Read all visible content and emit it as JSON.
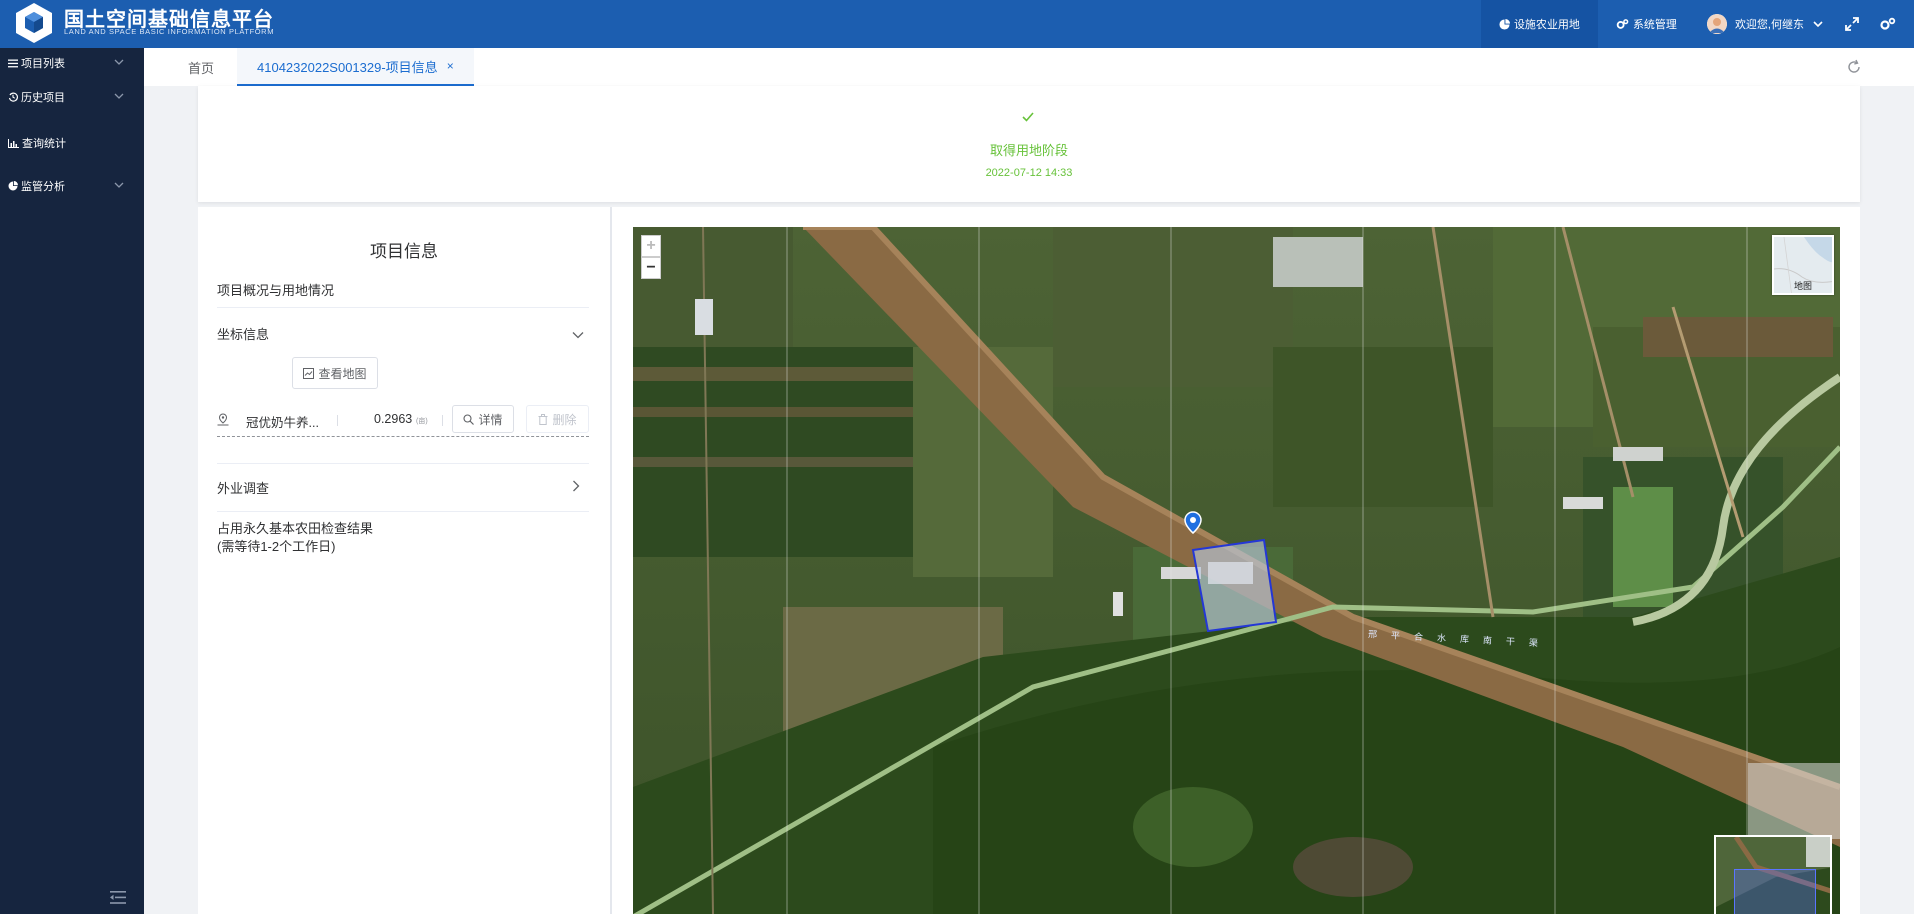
{
  "header": {
    "title": "国土空间基础信息平台",
    "subtitle": "LAND AND SPACE BASIC INFORMATION PLATFORM",
    "nav": [
      {
        "label": "设施农业用地",
        "icon": "pie-chart-icon",
        "active": true
      },
      {
        "label": "系统管理",
        "icon": "gears-icon",
        "active": false
      }
    ],
    "user_greeting": "欢迎您,何继东"
  },
  "sidebar": {
    "items": [
      {
        "label": "项目列表",
        "icon": "list-icon",
        "has_children": true
      },
      {
        "label": "历史项目",
        "icon": "history-icon",
        "has_children": true
      },
      {
        "label": "查询统计",
        "icon": "bar-chart-icon",
        "has_children": false
      },
      {
        "label": "监管分析",
        "icon": "pie-chart-icon",
        "has_children": true
      }
    ]
  },
  "tabs": [
    {
      "label": "首页",
      "active": false
    },
    {
      "label": "4104232022S001329-项目信息",
      "active": true,
      "close": "×"
    }
  ],
  "status": {
    "stage": "取得用地阶段",
    "time": "2022-07-12 14:33",
    "color": "#67c23a"
  },
  "project_panel": {
    "title": "项目信息",
    "overview": "项目概况与用地情况",
    "coords_section": "坐标信息",
    "view_map_button": "查看地图",
    "coord_row": {
      "name": "冠优奶牛养...",
      "area": "0.2963",
      "unit": "(亩)",
      "detail_button": "详情",
      "delete_button": "删除"
    },
    "field_survey": "外业调查",
    "farmland_check_title": "占用永久基本农田检查结果",
    "farmland_check_note": "(需等待1-2个工作日)"
  },
  "map": {
    "zoom_in": "+",
    "zoom_out": "−",
    "basemap_label": "地图",
    "road_label": "邢平合水库南干渠"
  },
  "colors": {
    "header_bg": "#1c5eb0",
    "sidebar_bg": "#16253f",
    "accent": "#1c6dd0",
    "success": "#67c23a"
  }
}
